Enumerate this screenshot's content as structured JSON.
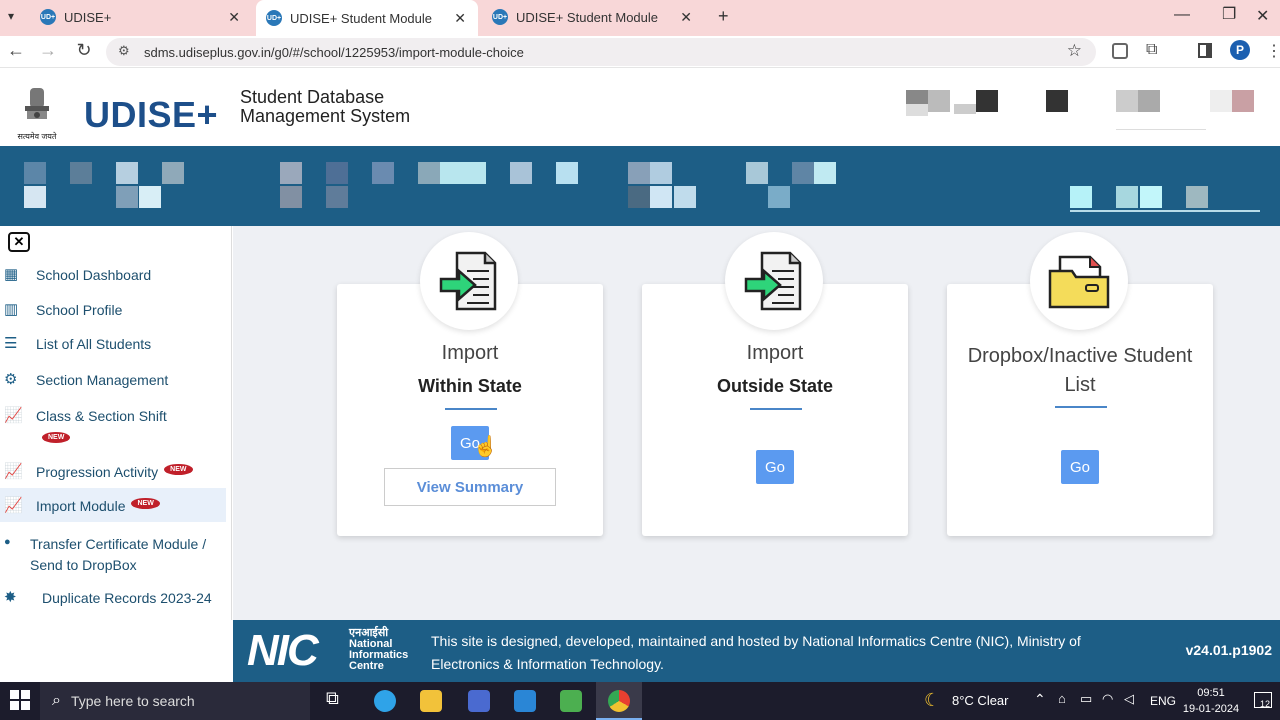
{
  "browser": {
    "tabs": [
      {
        "title": "UDISE+",
        "active": false
      },
      {
        "title": "UDISE+ Student Module",
        "active": true
      },
      {
        "title": "UDISE+ Student Module",
        "active": false
      }
    ],
    "url": "sdms.udiseplus.gov.in/g0/#/school/1225953/import-module-choice",
    "profile_initial": "P",
    "tab_favicon_text": "UD+"
  },
  "header": {
    "emblem_text": "सत्यमेव जयते",
    "logo": "UDISE+",
    "system_title_line1": "Student Database",
    "system_title_line2": "Management System"
  },
  "sidebar": {
    "items": [
      {
        "label": "School Dashboard",
        "icon": "grid-icon",
        "new": false
      },
      {
        "label": "School Profile",
        "icon": "building-icon",
        "new": false
      },
      {
        "label": "List of All Students",
        "icon": "students-list-icon",
        "new": false
      },
      {
        "label": "Section Management",
        "icon": "gears-icon",
        "new": false
      },
      {
        "label": "Class & Section Shift",
        "icon": "chart-line-icon",
        "new": true
      },
      {
        "label": "Progression Activity",
        "icon": "chart-line-icon",
        "new": true
      },
      {
        "label": "Import Module",
        "icon": "chart-line-icon",
        "new": true
      },
      {
        "label": "Transfer Certificate Module /",
        "label2": "Send to DropBox",
        "icon": "badge-icon",
        "new": false
      },
      {
        "label": "Duplicate Records 2023-24",
        "icon": "duplicate-icon",
        "new": false
      }
    ],
    "new_badge": "NEW"
  },
  "cards": [
    {
      "title": "Import",
      "subtitle": "Within State",
      "go": "Go",
      "summary": "View Summary",
      "icon": "import-document-icon"
    },
    {
      "title": "Import",
      "subtitle": "Outside State",
      "go": "Go",
      "icon": "import-document-icon"
    },
    {
      "title": "Dropbox/Inactive Student",
      "title2": "List",
      "go": "Go",
      "icon": "folder-icon"
    }
  ],
  "footer": {
    "nic_hindi": "एनआईसी",
    "nic_name1": "National",
    "nic_name2": "Informatics",
    "nic_name3": "Centre",
    "text1": "This site is designed, developed, maintained and hosted by National Informatics Centre (NIC), Ministry of",
    "text2": "Electronics & Information Technology.",
    "version": "v24.01.p1902"
  },
  "taskbar": {
    "search_placeholder": "Type here to search",
    "weather": "8°C  Clear",
    "lang": "ENG",
    "time": "09:51",
    "date": "19-01-2024",
    "notif_count": "12"
  }
}
